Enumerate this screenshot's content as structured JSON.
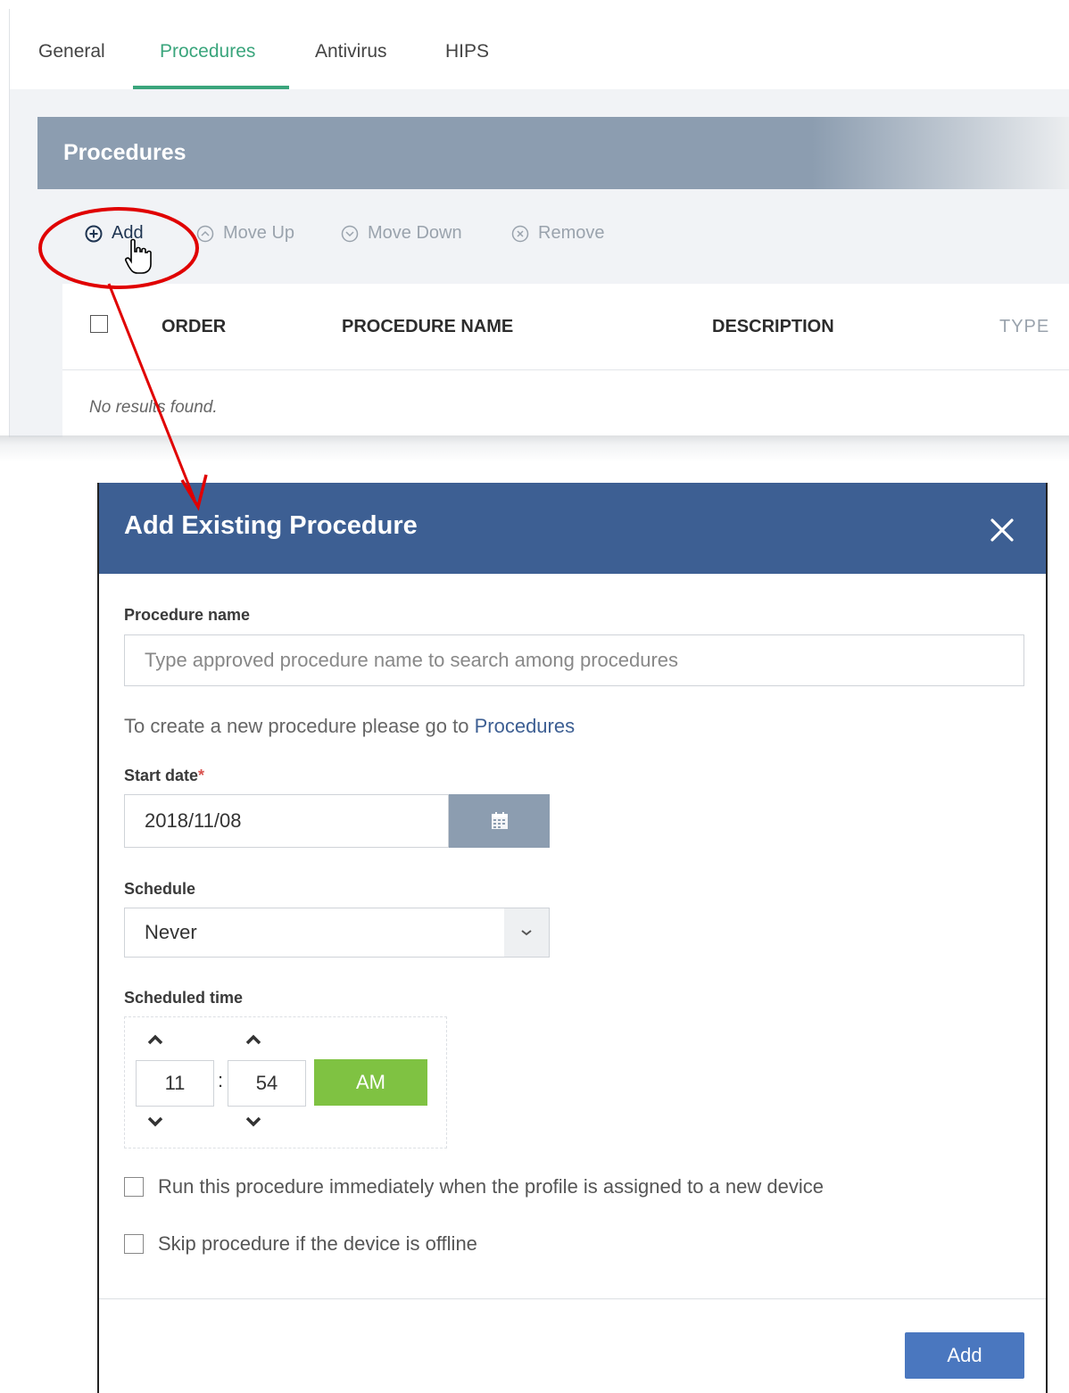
{
  "tabs": [
    {
      "label": "General"
    },
    {
      "label": "Procedures"
    },
    {
      "label": "Antivirus"
    },
    {
      "label": "HIPS"
    }
  ],
  "section": {
    "title": "Procedures"
  },
  "toolbar": {
    "add": "Add",
    "move_up": "Move Up",
    "move_down": "Move Down",
    "remove": "Remove"
  },
  "grid": {
    "columns": [
      "ORDER",
      "PROCEDURE NAME",
      "DESCRIPTION",
      "TYPE"
    ],
    "empty_text": "No results found."
  },
  "dialog": {
    "title": "Add Existing Procedure",
    "procedure_name_label": "Procedure name",
    "procedure_name_placeholder": "Type approved procedure name to search among procedures",
    "helper_text": "To create a new procedure please go to ",
    "helper_link": "Procedures",
    "start_date_label": "Start date",
    "required_mark": "*",
    "start_date_value": "2018/11/08",
    "schedule_label": "Schedule",
    "schedule_value": "Never",
    "scheduled_time_label": "Scheduled time",
    "hour": "11",
    "minute": "54",
    "colon": ":",
    "ampm": "AM",
    "run_immediately_label": "Run this procedure immediately when the profile is assigned to a new device",
    "skip_offline_label": "Skip procedure if the device is offline",
    "add_button": "Add"
  },
  "colors": {
    "accent_green": "#3aa57c",
    "header_gray": "#8c9db0",
    "dialog_header": "#3d5f93",
    "primary_button": "#4a77bf",
    "ampm_green": "#7fc242",
    "annotation_red": "#e00000"
  }
}
